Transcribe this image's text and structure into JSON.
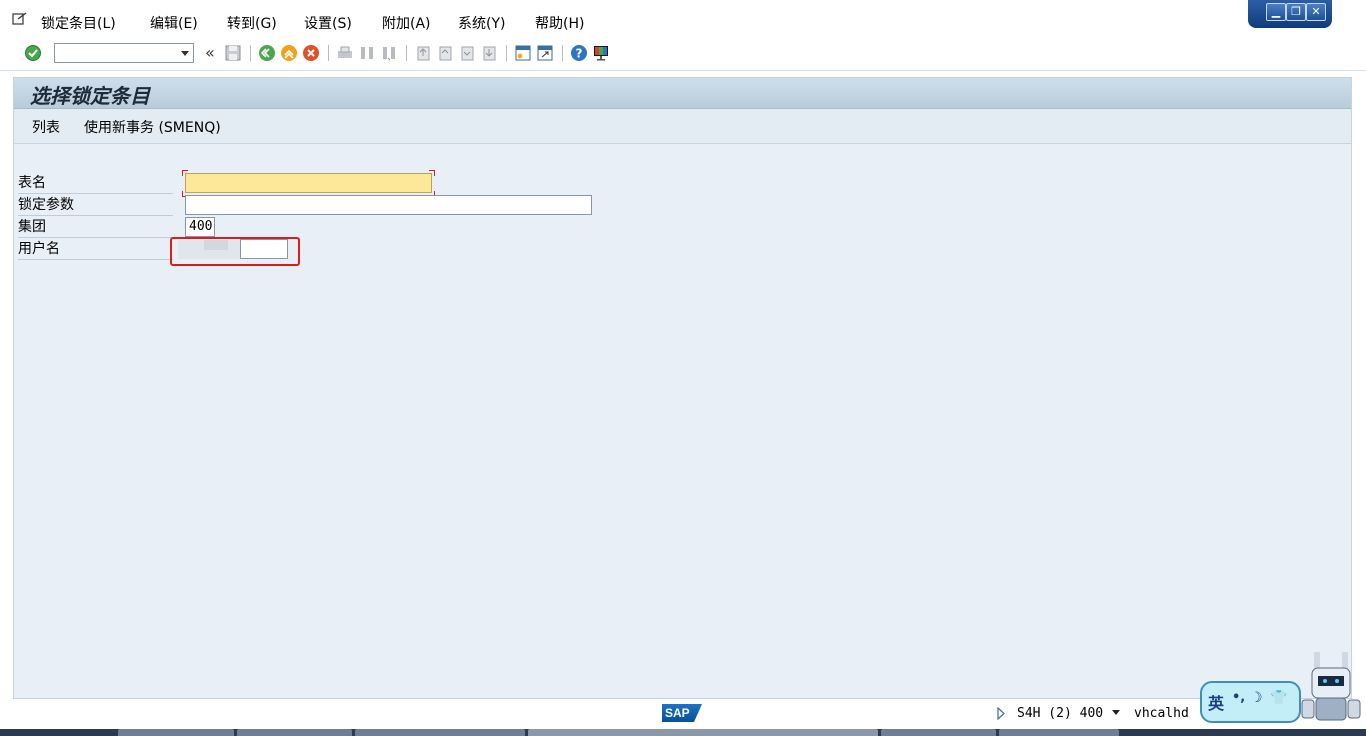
{
  "menubar": {
    "items": [
      "锁定条目(L)",
      "编辑(E)",
      "转到(G)",
      "设置(S)",
      "附加(A)",
      "系统(Y)",
      "帮助(H)"
    ]
  },
  "window_controls": {
    "minimize": "▁",
    "restore": "❐",
    "close": "✕"
  },
  "toolbar": {
    "command_value": "",
    "back_glyph": "«"
  },
  "page": {
    "title": "选择锁定条目",
    "app_toolbar": [
      "列表",
      "使用新事务 (SMENQ)"
    ]
  },
  "form": {
    "fields": [
      {
        "label": "表名",
        "value": ""
      },
      {
        "label": "锁定参数",
        "value": ""
      },
      {
        "label": "集团",
        "value": "400"
      },
      {
        "label": "用户名",
        "value": ""
      }
    ]
  },
  "status": {
    "logo": "SAP",
    "system": "S4H (2) 400",
    "server": "vhcalhd"
  },
  "ime": {
    "mode": "英",
    "punct": "•,",
    "moon": "☽",
    "shirt": "👕"
  },
  "colors": {
    "frame_bg": "#e9eff6",
    "required_field": "#fde89a",
    "highlight": "#e01b1b"
  }
}
